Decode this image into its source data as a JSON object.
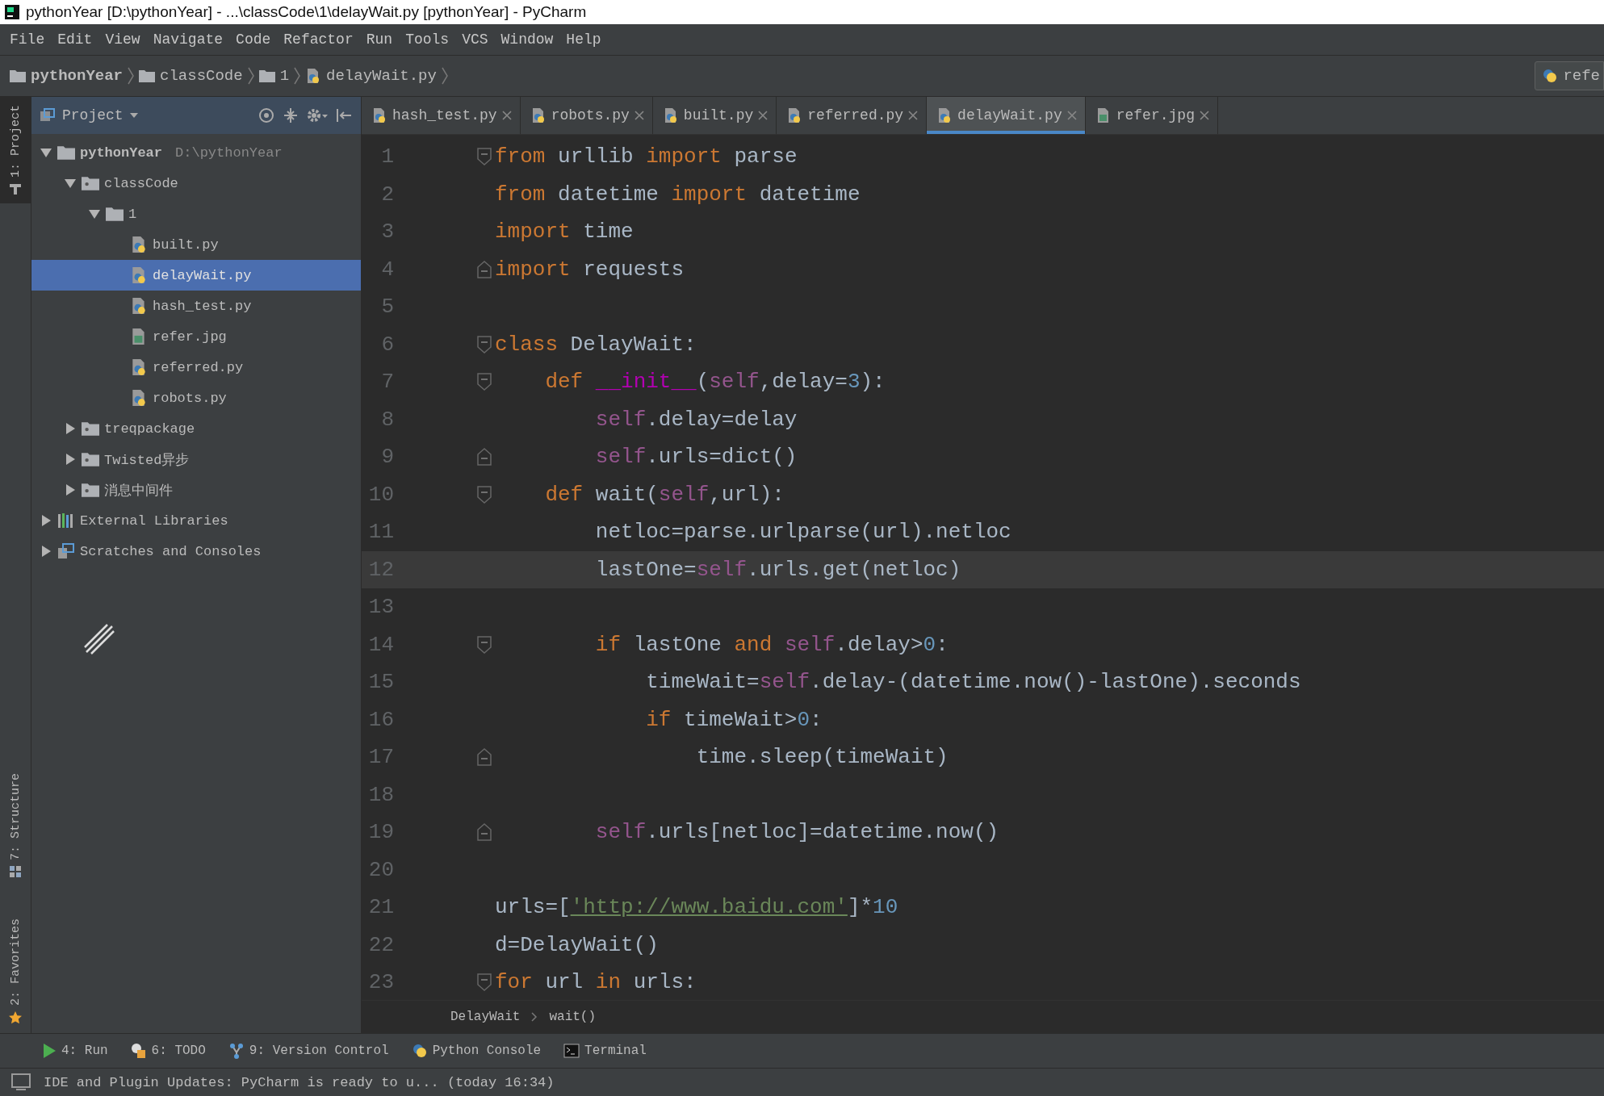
{
  "window": {
    "title": "pythonYear [D:\\pythonYear] - ...\\classCode\\1\\delayWait.py [pythonYear] - PyCharm"
  },
  "menu": [
    "File",
    "Edit",
    "View",
    "Navigate",
    "Code",
    "Refactor",
    "Run",
    "Tools",
    "VCS",
    "Window",
    "Help"
  ],
  "breadcrumb": [
    {
      "label": "pythonYear",
      "kind": "project"
    },
    {
      "label": "classCode",
      "kind": "folder"
    },
    {
      "label": "1",
      "kind": "folder"
    },
    {
      "label": "delayWait.py",
      "kind": "python"
    }
  ],
  "run_config": {
    "label": "refe"
  },
  "side_tabs": [
    {
      "label": "1: Project",
      "kind": "project",
      "selected": true
    },
    {
      "label": "7: Structure",
      "kind": "structure",
      "selected": false
    },
    {
      "label": "2: Favorites",
      "kind": "favorites",
      "selected": false
    }
  ],
  "project_panel": {
    "title": "Project",
    "tree": [
      {
        "label": "pythonYear",
        "path": "D:\\pythonYear",
        "kind": "project",
        "expanded": true,
        "selected": false,
        "children": [
          {
            "label": "classCode",
            "kind": "package",
            "expanded": true,
            "selected": false,
            "children": [
              {
                "label": "1",
                "kind": "folder",
                "expanded": true,
                "selected": false,
                "children": [
                  {
                    "label": "built.py",
                    "kind": "python",
                    "selected": false
                  },
                  {
                    "label": "delayWait.py",
                    "kind": "python",
                    "selected": true
                  },
                  {
                    "label": "hash_test.py",
                    "kind": "python",
                    "selected": false
                  },
                  {
                    "label": "refer.jpg",
                    "kind": "image",
                    "selected": false
                  },
                  {
                    "label": "referred.py",
                    "kind": "python",
                    "selected": false
                  },
                  {
                    "label": "robots.py",
                    "kind": "python",
                    "selected": false
                  }
                ]
              }
            ]
          },
          {
            "label": "treqpackage",
            "kind": "package",
            "expanded": false,
            "selected": false
          },
          {
            "label": "Twisted异步",
            "kind": "package",
            "expanded": false,
            "selected": false
          },
          {
            "label": "消息中间件",
            "kind": "package",
            "expanded": false,
            "selected": false
          }
        ]
      },
      {
        "label": "External Libraries",
        "kind": "libraries",
        "expanded": false,
        "selected": false
      },
      {
        "label": "Scratches and Consoles",
        "kind": "scratches",
        "expanded": false,
        "selected": false
      }
    ]
  },
  "editor_tabs": [
    {
      "label": "hash_test.py",
      "kind": "python",
      "selected": false
    },
    {
      "label": "robots.py",
      "kind": "python",
      "selected": false
    },
    {
      "label": "built.py",
      "kind": "python",
      "selected": false
    },
    {
      "label": "referred.py",
      "kind": "python",
      "selected": false
    },
    {
      "label": "delayWait.py",
      "kind": "python",
      "selected": true
    },
    {
      "label": "refer.jpg",
      "kind": "image",
      "selected": false
    }
  ],
  "code_lines": [
    {
      "number": "1",
      "fold_start": true,
      "fold_end": false,
      "current": false,
      "tokens": [
        {
          "text": "from",
          "kind": "keyword"
        },
        {
          "text": " urllib ",
          "kind": "plain"
        },
        {
          "text": "import",
          "kind": "keyword"
        },
        {
          "text": " parse",
          "kind": "plain"
        }
      ]
    },
    {
      "number": "2",
      "fold_start": false,
      "fold_end": false,
      "current": false,
      "tokens": [
        {
          "text": "from",
          "kind": "keyword"
        },
        {
          "text": " datetime ",
          "kind": "plain"
        },
        {
          "text": "import",
          "kind": "keyword"
        },
        {
          "text": " datetime",
          "kind": "plain"
        }
      ]
    },
    {
      "number": "3",
      "fold_start": false,
      "fold_end": false,
      "current": false,
      "tokens": [
        {
          "text": "import",
          "kind": "keyword"
        },
        {
          "text": " time",
          "kind": "plain"
        }
      ]
    },
    {
      "number": "4",
      "fold_start": false,
      "fold_end": true,
      "current": false,
      "tokens": [
        {
          "text": "import",
          "kind": "keyword"
        },
        {
          "text": " requests",
          "kind": "plain"
        }
      ]
    },
    {
      "number": "5",
      "fold_start": false,
      "fold_end": false,
      "current": false
    },
    {
      "number": "6",
      "fold_start": true,
      "fold_end": false,
      "current": false,
      "tokens": [
        {
          "text": "class",
          "kind": "keyword"
        },
        {
          "text": " DelayWait:",
          "kind": "plain"
        }
      ]
    },
    {
      "number": "7",
      "fold_start": true,
      "fold_end": false,
      "current": false,
      "tokens": [
        {
          "text": "    def ",
          "kind": "keyword"
        },
        {
          "text": "__init__",
          "kind": "magic"
        },
        {
          "text": "(",
          "kind": "plain"
        },
        {
          "text": "self",
          "kind": "self"
        },
        {
          "text": ",delay=",
          "kind": "plain"
        },
        {
          "text": "3",
          "kind": "number"
        },
        {
          "text": "):",
          "kind": "plain"
        }
      ]
    },
    {
      "number": "8",
      "fold_start": false,
      "fold_end": false,
      "current": false,
      "tokens": [
        {
          "text": "        self",
          "kind": "self"
        },
        {
          "text": ".delay=delay",
          "kind": "plain"
        }
      ]
    },
    {
      "number": "9",
      "fold_start": false,
      "fold_end": true,
      "current": false,
      "tokens": [
        {
          "text": "        self",
          "kind": "self"
        },
        {
          "text": ".urls=dict()",
          "kind": "plain"
        }
      ]
    },
    {
      "number": "10",
      "fold_start": true,
      "fold_end": false,
      "current": false,
      "tokens": [
        {
          "text": "    def",
          "kind": "keyword"
        },
        {
          "text": " wait(",
          "kind": "plain"
        },
        {
          "text": "self",
          "kind": "self"
        },
        {
          "text": ",url):",
          "kind": "plain"
        }
      ]
    },
    {
      "number": "11",
      "fold_start": false,
      "fold_end": false,
      "current": false,
      "tokens": [
        {
          "text": "        netloc=parse.urlparse(url).netloc",
          "kind": "plain"
        }
      ]
    },
    {
      "number": "12",
      "fold_start": false,
      "fold_end": false,
      "current": true,
      "tokens": [
        {
          "text": "        lastOne=",
          "kind": "plain"
        },
        {
          "text": "self",
          "kind": "self"
        },
        {
          "text": ".urls.get(netloc)",
          "kind": "plain"
        }
      ]
    },
    {
      "number": "13",
      "fold_start": false,
      "fold_end": false,
      "current": false
    },
    {
      "number": "14",
      "fold_start": true,
      "fold_end": false,
      "current": false,
      "tokens": [
        {
          "text": "        if",
          "kind": "keyword"
        },
        {
          "text": " lastOne ",
          "kind": "plain"
        },
        {
          "text": "and ",
          "kind": "keyword"
        },
        {
          "text": "self",
          "kind": "self"
        },
        {
          "text": ".delay>",
          "kind": "plain"
        },
        {
          "text": "0",
          "kind": "number"
        },
        {
          "text": ":",
          "kind": "plain"
        }
      ]
    },
    {
      "number": "15",
      "fold_start": false,
      "fold_end": false,
      "current": false,
      "tokens": [
        {
          "text": "            timeWait=",
          "kind": "plain"
        },
        {
          "text": "self",
          "kind": "self"
        },
        {
          "text": ".delay-(datetime.now()-lastOne).seconds",
          "kind": "plain"
        }
      ]
    },
    {
      "number": "16",
      "fold_start": false,
      "fold_end": false,
      "current": false,
      "tokens": [
        {
          "text": "            if",
          "kind": "keyword"
        },
        {
          "text": " timeWait>",
          "kind": "plain"
        },
        {
          "text": "0",
          "kind": "number"
        },
        {
          "text": ":",
          "kind": "plain"
        }
      ]
    },
    {
      "number": "17",
      "fold_start": false,
      "fold_end": true,
      "current": false,
      "tokens": [
        {
          "text": "                time.sleep(timeWait)",
          "kind": "plain"
        }
      ]
    },
    {
      "number": "18",
      "fold_start": false,
      "fold_end": false,
      "current": false
    },
    {
      "number": "19",
      "fold_start": false,
      "fold_end": true,
      "current": false,
      "tokens": [
        {
          "text": "        self",
          "kind": "self"
        },
        {
          "text": ".urls[netloc]=datetime.now()",
          "kind": "plain"
        }
      ]
    },
    {
      "number": "20",
      "fold_start": false,
      "fold_end": false,
      "current": false
    },
    {
      "number": "21",
      "fold_start": false,
      "fold_end": false,
      "current": false,
      "tokens": [
        {
          "text": "urls=[",
          "kind": "plain"
        },
        {
          "text": "'http://www.baidu.com'",
          "kind": "string"
        },
        {
          "text": "]*",
          "kind": "plain"
        },
        {
          "text": "10",
          "kind": "number"
        }
      ]
    },
    {
      "number": "22",
      "fold_start": false,
      "fold_end": false,
      "current": false,
      "tokens": [
        {
          "text": "d=DelayWait()",
          "kind": "plain"
        }
      ]
    },
    {
      "number": "23",
      "fold_start": true,
      "fold_end": false,
      "current": false,
      "tokens": [
        {
          "text": "for",
          "kind": "keyword"
        },
        {
          "text": " url ",
          "kind": "plain"
        },
        {
          "text": "in",
          "kind": "keyword"
        },
        {
          "text": " urls:",
          "kind": "plain"
        }
      ]
    }
  ],
  "editor_breadcrumb": [
    "DelayWait",
    "wait()"
  ],
  "tool_buttons": [
    {
      "label": "4: Run",
      "kind": "run"
    },
    {
      "label": "6: TODO",
      "kind": "todo"
    },
    {
      "label": "9: Version Control",
      "kind": "vcs"
    },
    {
      "label": "Python Console",
      "kind": "console"
    },
    {
      "label": "Terminal",
      "kind": "terminal"
    }
  ],
  "status_bar": {
    "text": "IDE and Plugin Updates: PyCharm is ready to u... (today 16:34)"
  }
}
